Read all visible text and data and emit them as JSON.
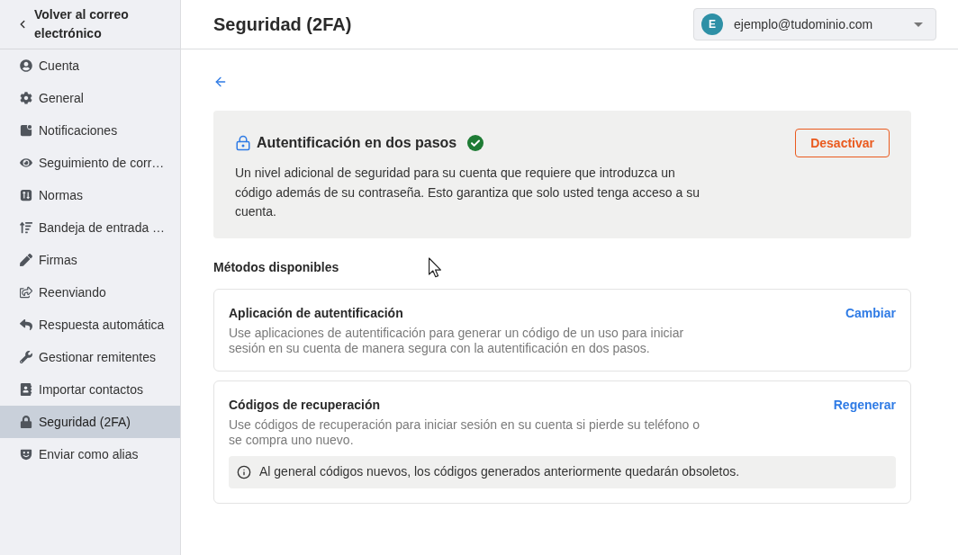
{
  "sidebar": {
    "back_link": "Volver al correo electrónico",
    "items": [
      {
        "label": "Cuenta",
        "selected": false
      },
      {
        "label": "General",
        "selected": false
      },
      {
        "label": "Notificaciones",
        "selected": false
      },
      {
        "label": "Seguimiento de corr…",
        "selected": false
      },
      {
        "label": "Normas",
        "selected": false
      },
      {
        "label": "Bandeja de entrada …",
        "selected": false
      },
      {
        "label": "Firmas",
        "selected": false
      },
      {
        "label": "Reenviando",
        "selected": false
      },
      {
        "label": "Respuesta automática",
        "selected": false
      },
      {
        "label": "Gestionar remitentes",
        "selected": false
      },
      {
        "label": "Importar contactos",
        "selected": false
      },
      {
        "label": "Seguridad (2FA)",
        "selected": true
      },
      {
        "label": "Enviar como alias",
        "selected": false
      }
    ]
  },
  "header": {
    "title": "Seguridad (2FA)",
    "account": {
      "avatar_letter": "E",
      "email": "ejemplo@tudominio.com"
    }
  },
  "two_step": {
    "title": "Autentificación en dos pasos",
    "enabled": true,
    "description": "Un nivel adicional de seguridad para su cuenta que requiere que introduzca un código además de su contraseña. Esto garantiza que solo usted tenga acceso a su cuenta.",
    "button": "Desactivar"
  },
  "methods": {
    "heading": "Métodos disponibles",
    "items": [
      {
        "title": "Aplicación de autentificación",
        "description": "Use aplicaciones de autentificación para generar un código de un uso para iniciar sesión en su cuenta de manera segura con la autentificación en dos pasos.",
        "action": "Cambiar"
      },
      {
        "title": "Códigos de recuperación",
        "description": "Use códigos de recuperación para iniciar sesión en su cuenta si pierde su teléfono o se compra uno nuevo.",
        "action": "Regenerar",
        "notice": "Al general códigos nuevos, los códigos generados anteriormente quedarán obsoletos."
      }
    ]
  }
}
